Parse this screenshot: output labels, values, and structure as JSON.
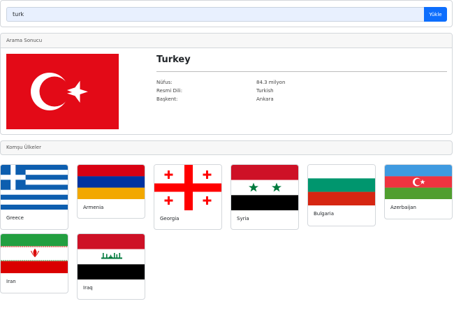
{
  "search": {
    "value": "turk",
    "button_label": "Yükle"
  },
  "result": {
    "header": "Arama Sonucu",
    "country": "Turkey",
    "flag_icon": "turkey-flag-icon",
    "fields": [
      {
        "label": "Nüfus:",
        "value": "84.3 milyon"
      },
      {
        "label": "Resmi Dili:",
        "value": "Turkish"
      },
      {
        "label": "Başkent:",
        "value": "Ankara"
      }
    ]
  },
  "neighbors": {
    "header": "Komşu Ülkeler",
    "countries": [
      {
        "name": "Greece",
        "flag_icon": "greece-flag-icon"
      },
      {
        "name": "Armenia",
        "flag_icon": "armenia-flag-icon"
      },
      {
        "name": "Georgia",
        "flag_icon": "georgia-flag-icon"
      },
      {
        "name": "Syria",
        "flag_icon": "syria-flag-icon"
      },
      {
        "name": "Bulgaria",
        "flag_icon": "bulgaria-flag-icon"
      },
      {
        "name": "Azerbaijan",
        "flag_icon": "azerbaijan-flag-icon"
      },
      {
        "name": "Iran",
        "flag_icon": "iran-flag-icon"
      },
      {
        "name": "Iraq",
        "flag_icon": "iraq-flag-icon"
      }
    ]
  },
  "colors": {
    "accent": "#0d6efd",
    "turkey_red": "#e30a17"
  }
}
